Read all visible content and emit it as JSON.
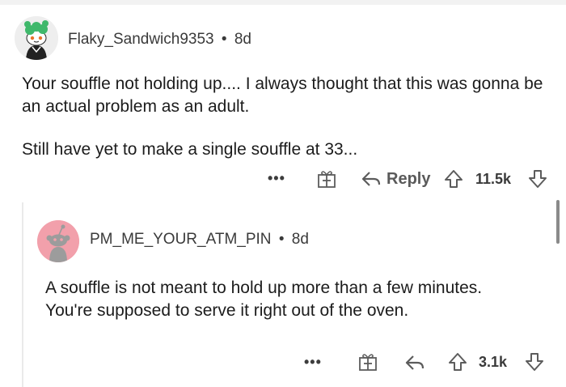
{
  "comment": {
    "author": "Flaky_Sandwich9353",
    "separator": "•",
    "age": "8d",
    "line1": "Your souffle not holding up.... I always thought that this was gonna be an actual problem as an adult.",
    "line2": "Still have yet to make a single souffle at 33...",
    "more_label": "•••",
    "reply_label": "Reply",
    "votes": "11.5k",
    "avatar_icon": "snoo-avatar-green-hair",
    "gift_icon": "gift-icon",
    "reply_icon": "reply-arrow-icon",
    "upvote_icon": "upvote-arrow-icon",
    "downvote_icon": "downvote-arrow-icon"
  },
  "reply": {
    "author": "PM_ME_YOUR_ATM_PIN",
    "separator": "•",
    "age": "8d",
    "text": "A souffle is not meant to hold up more than a few minutes. You're supposed to serve it right out of the oven.",
    "more_label": "•••",
    "votes": "3.1k",
    "avatar_icon": "default-snoo-avatar-pink",
    "avatar_color": "#f2a0ab"
  }
}
